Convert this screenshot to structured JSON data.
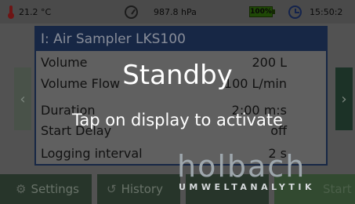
{
  "status": {
    "temperature": "21.2 °C",
    "pressure": "987.8 hPa",
    "battery": "100%",
    "time": "15:50:2"
  },
  "panel": {
    "title": "I: Air Sampler LKS100",
    "rows": [
      {
        "label": "Volume",
        "value": "200 L"
      },
      {
        "label": "Volume Flow",
        "value": "100 L/min"
      },
      {
        "label": "Duration",
        "value": "2:00 m:s"
      },
      {
        "label": "Start Delay",
        "value": "off"
      },
      {
        "label": "Logging interval",
        "value": "2 s"
      }
    ]
  },
  "nav": {
    "left": "‹",
    "right": "›"
  },
  "buttons": {
    "settings": "Settings",
    "history": "History",
    "start": "Start"
  },
  "standby": {
    "title": "Standby",
    "subtitle": "Tap on display to activate"
  },
  "logo": {
    "name": "holbach",
    "tagline": "UMWELTANALYTIK"
  },
  "icons": {
    "temperature": "thermometer-icon",
    "pressure": "gauge-icon",
    "battery": "battery-icon",
    "time": "clock-icon",
    "settings": "gear-icon",
    "history": "history-icon"
  },
  "colors": {
    "panel_header": "#233a66",
    "battery_fill": "#2f6a0a",
    "thermometer": "#a32020",
    "button_bg": "#3a4f3f"
  }
}
